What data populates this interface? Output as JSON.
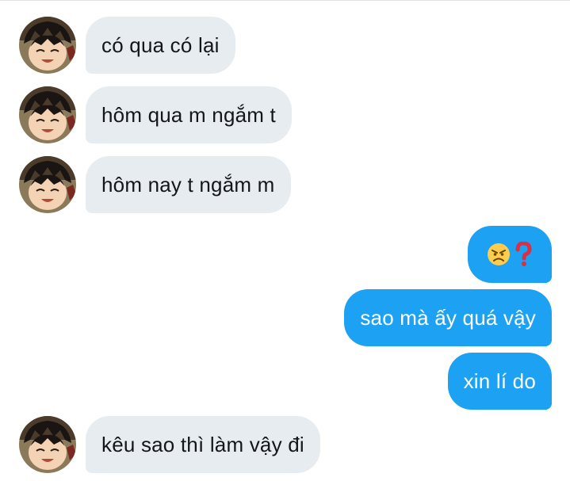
{
  "conversation": {
    "messages": [
      {
        "side": "in",
        "text": "có qua có lại"
      },
      {
        "side": "in",
        "text": "hôm qua m ngắm t"
      },
      {
        "side": "in",
        "text": "hôm nay t ngắm m"
      },
      {
        "side": "out",
        "text": "",
        "emoji": [
          "angry-face-icon",
          "red-question-mark-icon"
        ]
      },
      {
        "side": "out",
        "text": "sao mà ấy quá vậy"
      },
      {
        "side": "out",
        "text": "xin lí do"
      },
      {
        "side": "in",
        "text": "kêu sao thì làm vậy đi"
      }
    ]
  },
  "colors": {
    "incoming_bubble": "#e6ecf0",
    "outgoing_bubble": "#1da1f2",
    "incoming_text": "#14171a",
    "outgoing_text": "#ffffff"
  }
}
